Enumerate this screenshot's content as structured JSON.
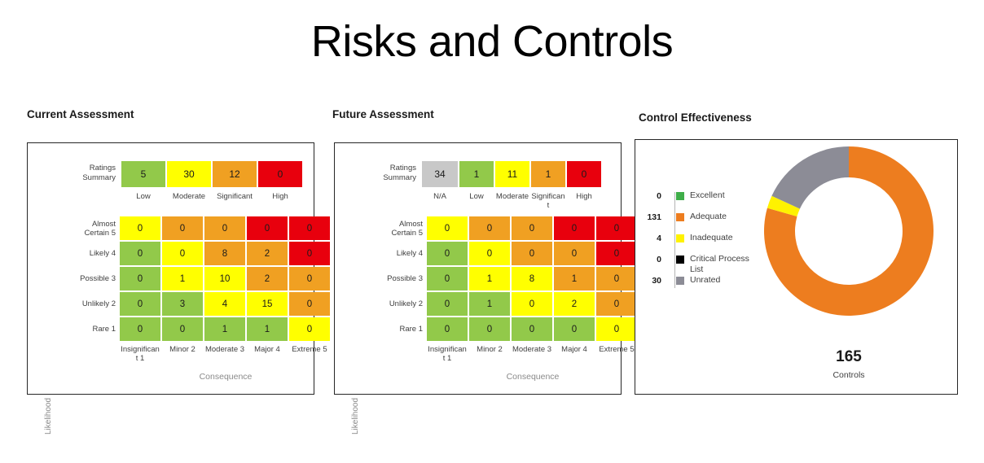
{
  "page_title": "Risks and Controls",
  "sections": {
    "current": {
      "heading": "Current Assessment"
    },
    "future": {
      "heading": "Future Assessment"
    },
    "control": {
      "heading": "Control Effectiveness"
    }
  },
  "colors": {
    "green": "#92C94A",
    "yellow": "#FFFF00",
    "orange": "#F0A022",
    "red": "#E8000D",
    "grey": "#C8C8C8",
    "donut_excellent": "#3FAE49",
    "donut_adequate": "#ED7D1F",
    "donut_inadequate": "#FFF200",
    "donut_critical": "#000000",
    "donut_unrated": "#8C8C96",
    "panel_border": "#262626"
  },
  "current_assessment": {
    "ratings_summary_label": "Ratings\nSummary",
    "ratings_summary": {
      "labels": [
        "Low",
        "Moderate",
        "Significant",
        "High"
      ],
      "values": [
        "5",
        "30",
        "12",
        "0"
      ],
      "colors": [
        "#92C94A",
        "#FFFF00",
        "#F0A022",
        "#E8000D"
      ],
      "widths": [
        54,
        54,
        54,
        54
      ]
    },
    "axis": {
      "y_title": "Likelihood",
      "x_title": "Consequence",
      "y_labels": [
        "Almost\nCertain 5",
        "Likely  4",
        "Possible  3",
        "Unlikely  2",
        "Rare  1"
      ],
      "x_labels": [
        "Insignificant 1",
        "Minor 2",
        "Moderate 3",
        "Major  4",
        "Extreme 5"
      ]
    },
    "chart_data": {
      "type": "heatmap",
      "title": "Current Assessment",
      "xlabel": "Consequence",
      "ylabel": "Likelihood",
      "x": [
        "Insignificant 1",
        "Minor 2",
        "Moderate 3",
        "Major 4",
        "Extreme 5"
      ],
      "y": [
        "Almost Certain 5",
        "Likely 4",
        "Possible 3",
        "Unlikely 2",
        "Rare 1"
      ],
      "rows": [
        {
          "values": [
            "0",
            "0",
            "0",
            "0",
            "0"
          ],
          "colors": [
            "#FFFF00",
            "#F0A022",
            "#F0A022",
            "#E8000D",
            "#E8000D"
          ]
        },
        {
          "values": [
            "0",
            "0",
            "8",
            "2",
            "0"
          ],
          "colors": [
            "#92C94A",
            "#FFFF00",
            "#F0A022",
            "#F0A022",
            "#E8000D"
          ]
        },
        {
          "values": [
            "0",
            "1",
            "10",
            "2",
            "0"
          ],
          "colors": [
            "#92C94A",
            "#FFFF00",
            "#FFFF00",
            "#F0A022",
            "#F0A022"
          ]
        },
        {
          "values": [
            "0",
            "3",
            "4",
            "15",
            "0"
          ],
          "colors": [
            "#92C94A",
            "#92C94A",
            "#FFFF00",
            "#FFFF00",
            "#F0A022"
          ]
        },
        {
          "values": [
            "0",
            "0",
            "1",
            "1",
            "0"
          ],
          "colors": [
            "#92C94A",
            "#92C94A",
            "#92C94A",
            "#92C94A",
            "#FFFF00"
          ]
        }
      ]
    }
  },
  "future_assessment": {
    "ratings_summary_label": "Ratings\nSummary",
    "ratings_summary": {
      "labels": [
        "N/A",
        "Low",
        "Moderate",
        "Significant",
        "High"
      ],
      "values": [
        "34",
        "1",
        "11",
        "1",
        "0"
      ],
      "colors": [
        "#C8C8C8",
        "#92C94A",
        "#FFFF00",
        "#F0A022",
        "#E8000D"
      ],
      "widths": [
        44,
        42,
        42,
        42,
        42
      ]
    },
    "axis": {
      "y_title": "Likelihood",
      "x_title": "Consequence",
      "y_labels": [
        "Almost\nCertain 5",
        "Likely  4",
        "Possible  3",
        "Unlikely  2",
        "Rare  1"
      ],
      "x_labels": [
        "Insignificant 1",
        "Minor 2",
        "Moderate 3",
        "Major  4",
        "Extreme 5"
      ]
    },
    "chart_data": {
      "type": "heatmap",
      "title": "Future Assessment",
      "xlabel": "Consequence",
      "ylabel": "Likelihood",
      "x": [
        "Insignificant 1",
        "Minor 2",
        "Moderate 3",
        "Major 4",
        "Extreme 5"
      ],
      "y": [
        "Almost Certain 5",
        "Likely 4",
        "Possible 3",
        "Unlikely 2",
        "Rare 1"
      ],
      "rows": [
        {
          "values": [
            "0",
            "0",
            "0",
            "0",
            "0"
          ],
          "colors": [
            "#FFFF00",
            "#F0A022",
            "#F0A022",
            "#E8000D",
            "#E8000D"
          ]
        },
        {
          "values": [
            "0",
            "0",
            "0",
            "0",
            "0"
          ],
          "colors": [
            "#92C94A",
            "#FFFF00",
            "#F0A022",
            "#F0A022",
            "#E8000D"
          ]
        },
        {
          "values": [
            "0",
            "1",
            "8",
            "1",
            "0"
          ],
          "colors": [
            "#92C94A",
            "#FFFF00",
            "#FFFF00",
            "#F0A022",
            "#F0A022"
          ]
        },
        {
          "values": [
            "0",
            "1",
            "0",
            "2",
            "0"
          ],
          "colors": [
            "#92C94A",
            "#92C94A",
            "#FFFF00",
            "#FFFF00",
            "#F0A022"
          ]
        },
        {
          "values": [
            "0",
            "0",
            "0",
            "0",
            "0"
          ],
          "colors": [
            "#92C94A",
            "#92C94A",
            "#92C94A",
            "#92C94A",
            "#FFFF00"
          ]
        }
      ]
    }
  },
  "control_effectiveness": {
    "center_value": "165",
    "center_label": "Controls",
    "chart_data": {
      "type": "pie",
      "title": "Control Effectiveness",
      "legend_position": "left",
      "total": 165,
      "categories": [
        "Excellent",
        "Adequate",
        "Inadequate",
        "Critical Process List",
        "Unrated"
      ],
      "values": [
        0,
        131,
        4,
        0,
        30
      ],
      "colors": [
        "#3FAE49",
        "#ED7D1F",
        "#FFF200",
        "#000000",
        "#8C8C96"
      ],
      "segments": [
        {
          "label": "Excellent",
          "value": 0,
          "display_value": "0",
          "color": "#3FAE49"
        },
        {
          "label": "Adequate",
          "value": 131,
          "display_value": "131",
          "color": "#ED7D1F"
        },
        {
          "label": "Inadequate",
          "value": 4,
          "display_value": "4",
          "color": "#FFF200"
        },
        {
          "label": "Critical Process List",
          "value": 0,
          "display_value": "0",
          "color": "#000000"
        },
        {
          "label": "Unrated",
          "value": 30,
          "display_value": "30",
          "color": "#8C8C96"
        }
      ]
    }
  }
}
